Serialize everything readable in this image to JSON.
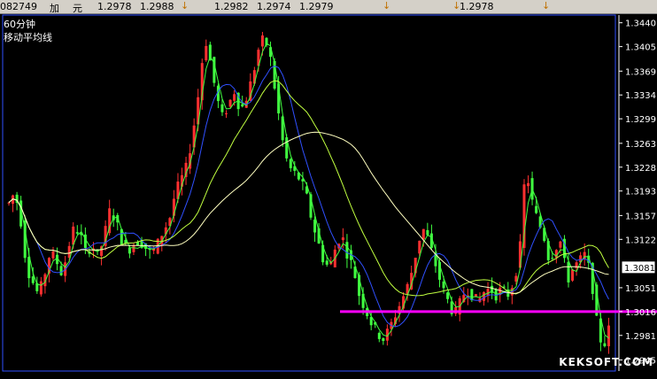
{
  "quote_bar": {
    "code": "082749",
    "label_a": "加",
    "label_b": "元",
    "values": [
      "1.2978",
      "1.2988",
      "1.2982",
      "1.2974",
      "1.2979"
    ],
    "last": "1.2978"
  },
  "chart_header": {
    "period": "60分钟",
    "indicator": "移动平均线"
  },
  "current_price": "1.3081",
  "watermark": "KEKSOFT.COM",
  "colors": {
    "price_up": "#ff3030",
    "price_down": "#40ff40",
    "ma_fast": "#40ff40",
    "ma_mid": "#3050ff",
    "ma_slow": "#ffffc0",
    "ma_long": "#c0ff40",
    "support_line": "#ff00ff",
    "frame": "#3050ff"
  },
  "chart_data": {
    "type": "line",
    "title": "",
    "xlabel": "",
    "ylabel": "",
    "ylim": [
      1.293,
      1.345
    ],
    "y_ticks": [
      "1.3440",
      "1.3405",
      "1.3369",
      "1.3334",
      "1.3299",
      "1.3263",
      "1.3228",
      "1.3193",
      "1.3157",
      "1.3122",
      "1.3051",
      "1.3016",
      "1.2981",
      "1.2945"
    ],
    "support_level": 1.3016,
    "series": [
      {
        "values": [
          1.3175,
          1.3192,
          1.315,
          1.308,
          1.306,
          1.304,
          1.307,
          1.3105,
          1.309,
          1.307,
          1.311,
          1.314,
          1.313,
          1.31,
          1.3115,
          1.3095,
          1.3125,
          1.3165,
          1.315,
          1.312,
          1.3105,
          1.3115,
          1.312,
          1.311,
          1.31,
          1.3115,
          1.3135,
          1.315,
          1.319,
          1.321,
          1.323,
          1.328,
          1.334,
          1.342,
          1.338,
          1.333,
          1.33,
          1.332,
          1.334,
          1.331,
          1.333,
          1.336,
          1.34,
          1.342,
          1.339,
          1.333,
          1.327,
          1.323,
          1.322,
          1.321,
          1.319,
          1.315,
          1.312,
          1.309,
          1.308,
          1.311,
          1.313,
          1.31,
          1.308,
          1.304,
          1.302,
          1.3,
          1.2985,
          1.2975,
          1.299,
          1.301,
          1.303,
          1.305,
          1.308,
          1.312,
          1.314,
          1.311,
          1.308,
          1.305,
          1.303,
          1.301,
          1.303,
          1.305,
          1.304,
          1.303,
          1.3045,
          1.305,
          1.304,
          1.305,
          1.304,
          1.306,
          1.31,
          1.323,
          1.318,
          1.315,
          1.313,
          1.309,
          1.311,
          1.312,
          1.306,
          1.308,
          1.309,
          1.31,
          1.307,
          1.3,
          1.296,
          1.299
        ]
      }
    ]
  }
}
